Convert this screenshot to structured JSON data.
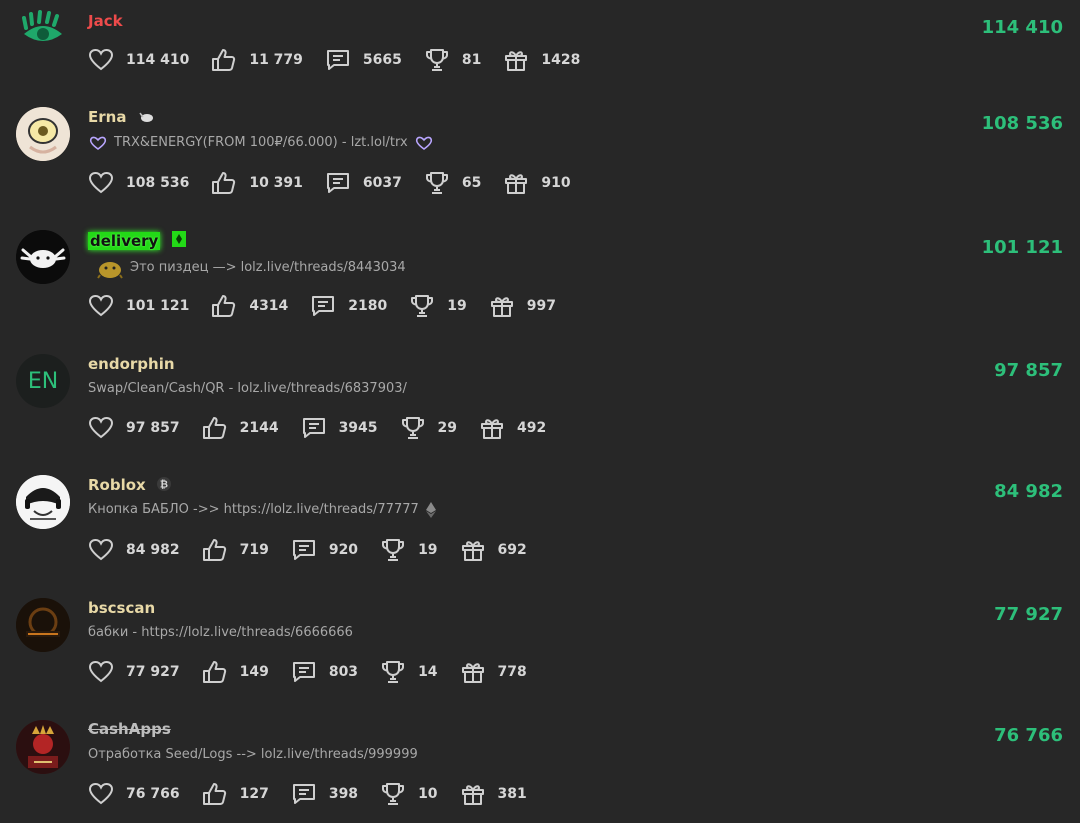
{
  "leaderboard": [
    {
      "username": "Jack",
      "status": "",
      "score": "114 410",
      "stats": {
        "likes": "114 410",
        "thumbs": "11 779",
        "messages": "5665",
        "trophies": "81",
        "gifts": "1428"
      }
    },
    {
      "username": "Erna",
      "status": "TRX&ENERGY(FROM 100₽/66.000) - lzt.lol/trx",
      "score": "108 536",
      "stats": {
        "likes": "108 536",
        "thumbs": "10 391",
        "messages": "6037",
        "trophies": "65",
        "gifts": "910"
      }
    },
    {
      "username": "delivery",
      "status": "Это пиздец —> lolz.live/threads/8443034",
      "score": "101 121",
      "stats": {
        "likes": "101 121",
        "thumbs": "4314",
        "messages": "2180",
        "trophies": "19",
        "gifts": "997"
      }
    },
    {
      "username": "endorphin",
      "avatar_text": "EN",
      "status": "Swap/Clean/Cash/QR - lolz.live/threads/6837903/",
      "score": "97 857",
      "stats": {
        "likes": "97 857",
        "thumbs": "2144",
        "messages": "3945",
        "trophies": "29",
        "gifts": "492"
      }
    },
    {
      "username": "Roblox",
      "status": "Кнопка БАБЛО ->> https://lolz.live/threads/77777",
      "score": "84 982",
      "stats": {
        "likes": "84 982",
        "thumbs": "719",
        "messages": "920",
        "trophies": "19",
        "gifts": "692"
      }
    },
    {
      "username": "bscscan",
      "status": "бабки - https://lolz.live/threads/6666666",
      "score": "77 927",
      "stats": {
        "likes": "77 927",
        "thumbs": "149",
        "messages": "803",
        "trophies": "14",
        "gifts": "778"
      }
    },
    {
      "username": "CashApps",
      "status": "Отработка Seed/Logs --> lolz.live/threads/999999",
      "score": "76 766",
      "stats": {
        "likes": "76 766",
        "thumbs": "127",
        "messages": "398",
        "trophies": "10",
        "gifts": "381"
      }
    }
  ],
  "colors": {
    "background": "#272727",
    "score": "#2dbf7a",
    "username": "#e8d9a7",
    "username_red": "#ef4b4b",
    "status": "#a8a8a8"
  },
  "icons": [
    "heart-icon",
    "thumbs-up-icon",
    "message-icon",
    "trophy-icon",
    "gift-icon"
  ]
}
